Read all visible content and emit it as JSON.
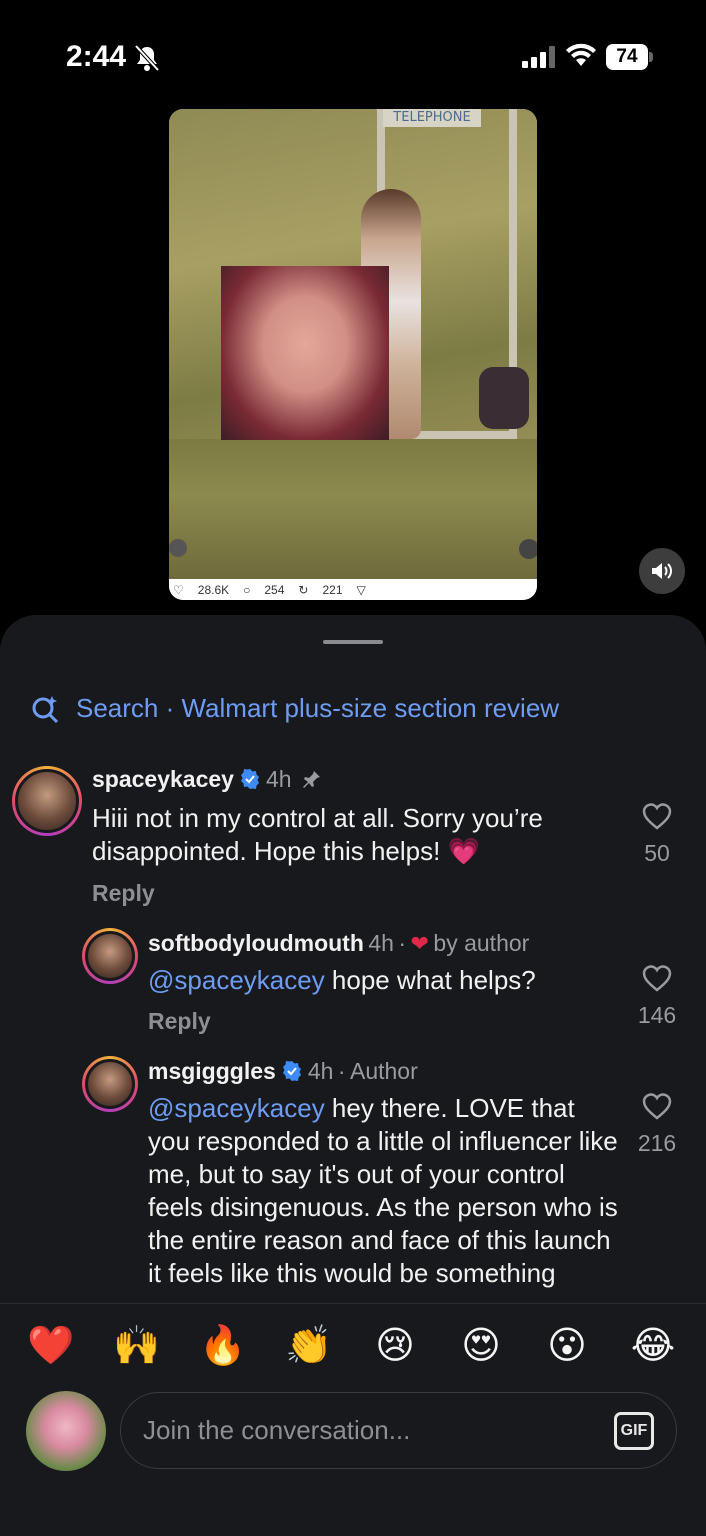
{
  "status_bar": {
    "time": "2:44",
    "battery": "74"
  },
  "video": {
    "sign": "TELEPHONE",
    "likes": "28.6K",
    "comments": "254",
    "reposts": "221"
  },
  "search": {
    "label": "Search · Walmart plus-size section review"
  },
  "comments": [
    {
      "username": "spaceykacey",
      "time": "4h",
      "text": "Hiii not in my control at all. Sorry you’re disappointed. Hope this helps! 💗",
      "reply": "Reply",
      "likes": "50"
    },
    {
      "username": "softbodyloudmouth",
      "time": "4h",
      "tag": "by author",
      "mention": "@spaceykacey",
      "text": " hope what helps?",
      "reply": "Reply",
      "likes": "146"
    },
    {
      "username": "msgigggles",
      "time": "4h",
      "tag": "Author",
      "mention": "@spaceykacey",
      "text": " hey there. LOVE that you responded to a little ol influencer like me, but to say it's out of your control feels disingenuous. As the person who is the entire reason and face of this launch it feels like this would be something",
      "likes": "216"
    }
  ],
  "emojis": [
    "❤️",
    "🙌",
    "🔥",
    "👏",
    "😢",
    "😍",
    "😮",
    "😂"
  ],
  "composer": {
    "placeholder": "Join the conversation...",
    "gif": "GIF"
  }
}
